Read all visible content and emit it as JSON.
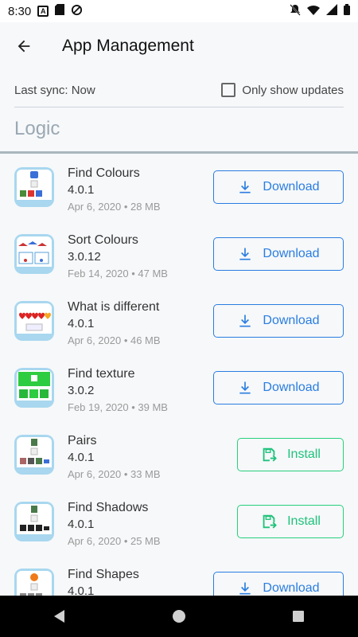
{
  "status": {
    "time": "8:30"
  },
  "header": {
    "title": "App Management"
  },
  "sync": {
    "label": "Last sync: Now",
    "checkbox_label": "Only show updates",
    "checked": false
  },
  "section": {
    "title": "Logic"
  },
  "apps": [
    {
      "name": "Find Colours",
      "version": "4.0.1",
      "meta": "Apr 6, 2020 • 28 MB",
      "action": "Download"
    },
    {
      "name": "Sort Colours",
      "version": "3.0.12",
      "meta": "Feb 14, 2020 • 47 MB",
      "action": "Download"
    },
    {
      "name": "What is different",
      "version": "4.0.1",
      "meta": "Apr 6, 2020 • 46 MB",
      "action": "Download"
    },
    {
      "name": "Find texture",
      "version": "3.0.2",
      "meta": "Feb 19, 2020 • 39 MB",
      "action": "Download"
    },
    {
      "name": "Pairs",
      "version": "4.0.1",
      "meta": "Apr 6, 2020 • 33 MB",
      "action": "Install"
    },
    {
      "name": "Find Shadows",
      "version": "4.0.1",
      "meta": "Apr 6, 2020 • 25 MB",
      "action": "Install"
    },
    {
      "name": "Find Shapes",
      "version": "4.0.1",
      "meta": "",
      "action": "Download"
    }
  ],
  "colors": {
    "download": "#2a7de1",
    "install": "#1ec27a",
    "background": "#f6f8fa"
  },
  "icons": {
    "back": "arrow-left-icon",
    "download": "download-icon",
    "install": "install-icon"
  }
}
